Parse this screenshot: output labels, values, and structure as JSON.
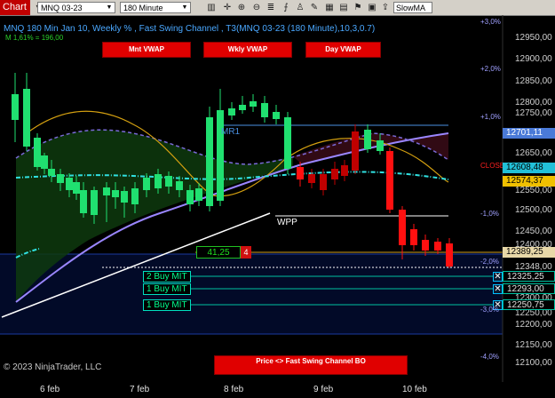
{
  "toolbar": {
    "chart_tab": "Chart",
    "instrument": "MNQ 03-23",
    "interval": "180 Minute",
    "indicator_input": "SlowMA"
  },
  "chart": {
    "title": "MNQ 180 Min Jan 10, Weekly % , Fast Swing Channel , T3(MNQ 03-23 (180 Minute),10,3,0.7)",
    "subtitle": "M 1,61% = 196,00",
    "buttons": {
      "monthly_vwap": "Mnt VWAP",
      "weekly_vwap": "Wkly VWAP",
      "day_vwap": "Day VWAP",
      "price_swing": "Price <> Fast Swing Channel BO"
    },
    "labels": {
      "mr1": "MR1",
      "wpp": "WPP",
      "close": "CLOSE",
      "copyright": "© 2023 NinjaTrader, LLC"
    },
    "order_qty": "41,25",
    "order_count": "4",
    "buy_orders": [
      "2  Buy MIT",
      "1  Buy MIT",
      "1  Buy MIT"
    ],
    "y_ticks": [
      "12950,00",
      "12900,00",
      "12850,00",
      "12800,00",
      "12750,00",
      "12650,00",
      "12550,00",
      "12500,00",
      "12450,00",
      "12400,00",
      "12348,00",
      "12300,00",
      "12250,00",
      "12200,00",
      "12150,00",
      "12100,00"
    ],
    "price_markers": {
      "p1": "12701,11",
      "p2": "12608,48",
      "p3": "12574,37",
      "p4": "12389,25",
      "p5": "12325,25",
      "p6": "12293,00",
      "p7": "12250,75"
    },
    "pct_ticks": [
      "+3,0%",
      "+2,0%",
      "+1,0%",
      "-1,0%",
      "-2,0%",
      "-3,0%",
      "-4,0%"
    ],
    "x_ticks": [
      "6 feb",
      "7 feb",
      "8 feb",
      "9 feb",
      "10 feb"
    ],
    "colors": {
      "up_candle": "#20e070",
      "down_candle": "#ff1010",
      "doji_candle": "#c00000",
      "channel_fill": "#0e3a0e",
      "ma_line": "#9a86ff",
      "slow_line": "#d4a010",
      "teal_line": "#30e0e0"
    }
  }
}
